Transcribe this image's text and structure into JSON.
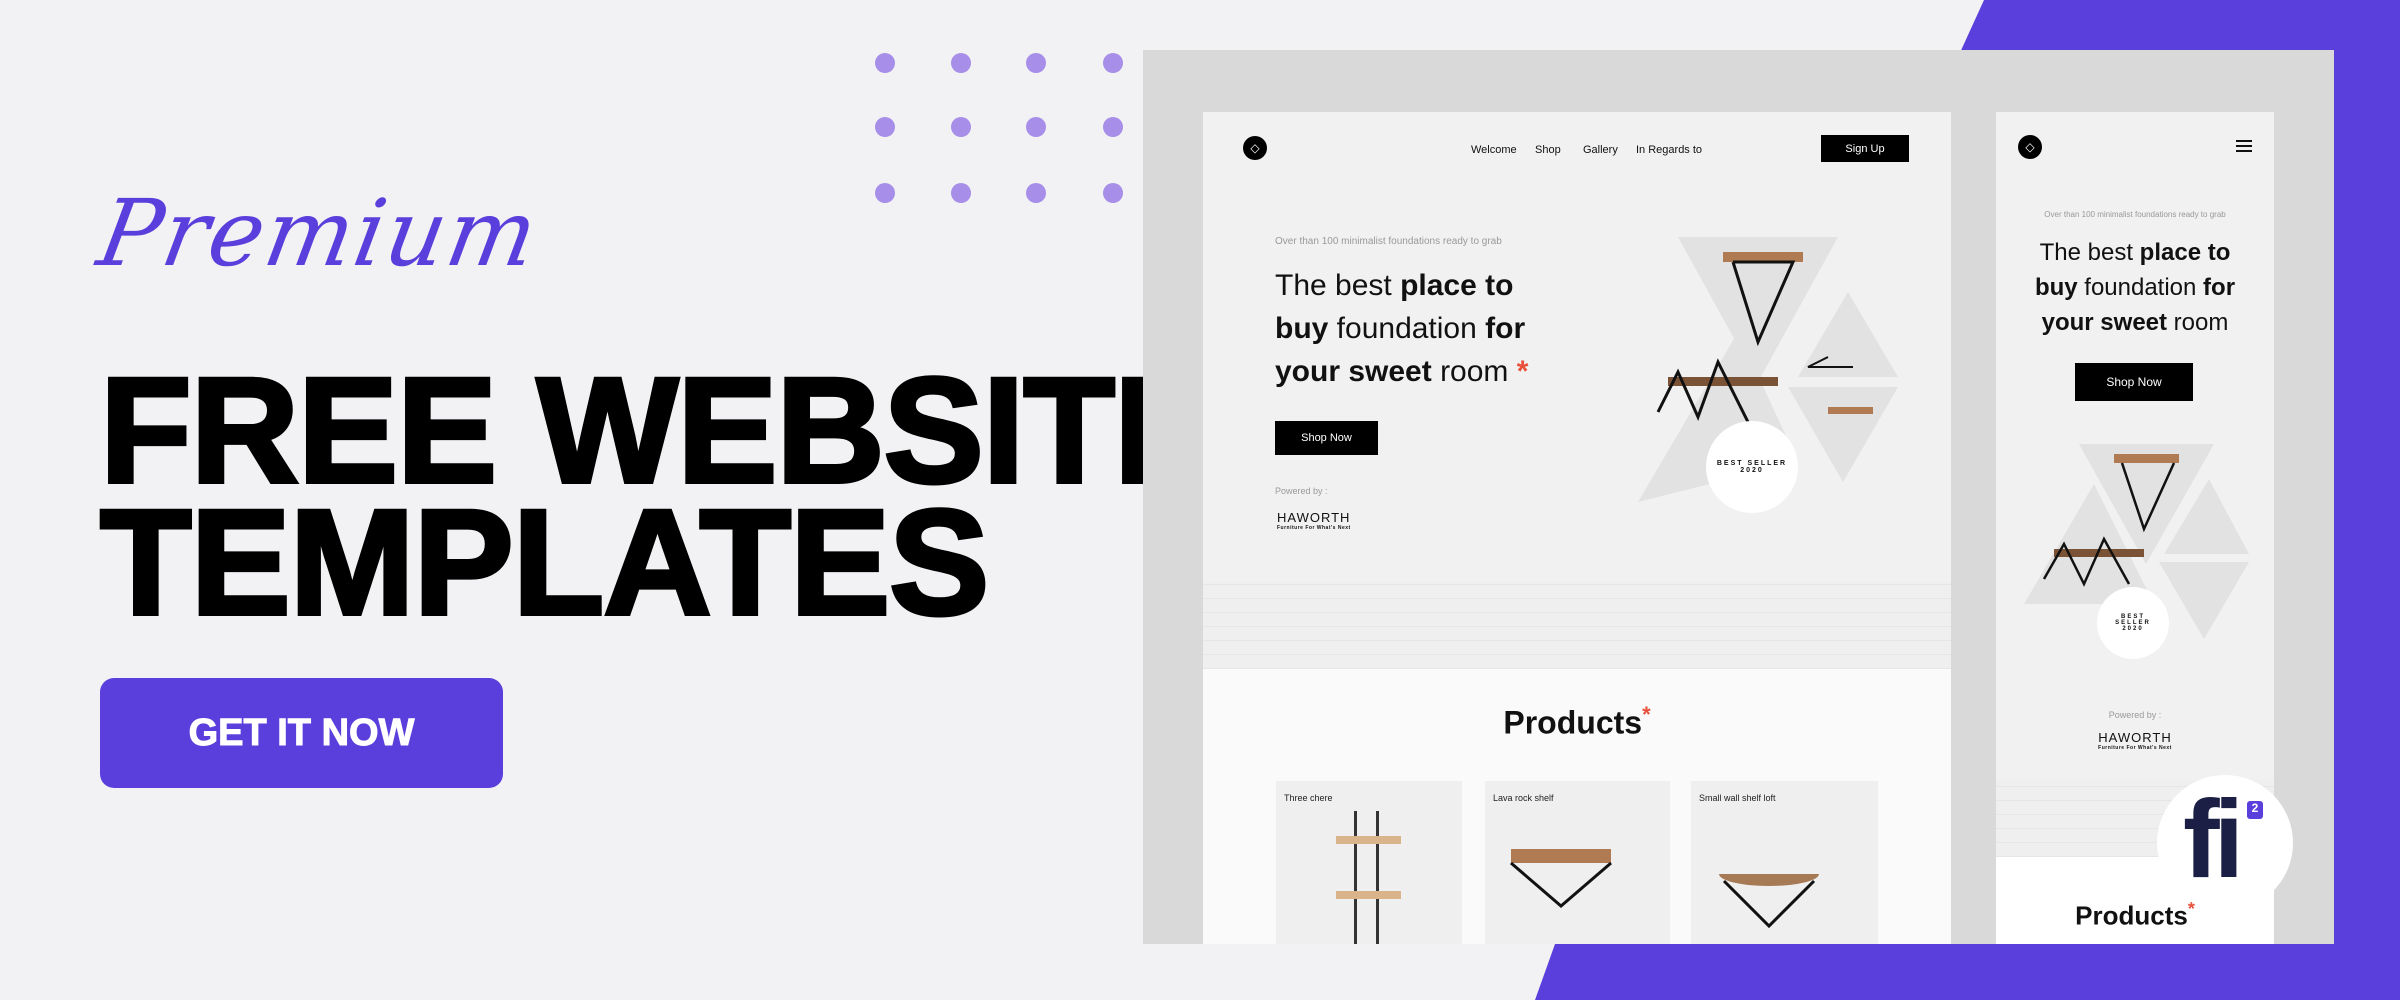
{
  "colors": {
    "accent": "#5b3fdc",
    "dots": "#a78ee8",
    "asterisk": "#e8503a",
    "background": "#f2f2f4"
  },
  "banner": {
    "script_title": "Premium",
    "headline_line1": "FREE WEBSITE",
    "headline_line2": "TEMPLATES",
    "cta_label": "GET IT NOW"
  },
  "desktop": {
    "logo_icon": "diamond-icon",
    "nav": [
      "Welcome",
      "Shop",
      "Gallery",
      "In Regards to"
    ],
    "signup_label": "Sign Up",
    "subtitle": "Over than 100 minimalist foundations ready to grab",
    "headline": {
      "l1a": "The best ",
      "l1b": "place to",
      "l2a": "buy",
      "l2b": " foundation ",
      "l2c": "for",
      "l3a": "your sweet",
      "l3b": " room ",
      "asterisk": "*"
    },
    "shop_now_label": "Shop Now",
    "powered_by": "Powered by :",
    "brand": "HAWORTH",
    "brand_tagline": "Furniture For What's Next",
    "badge": "BEST SELLER 2020",
    "products_title": "Products",
    "products_asterisk": "*",
    "cards": [
      {
        "label": "Three chere"
      },
      {
        "label": "Lava rock shelf"
      },
      {
        "label": "Small wall shelf loft"
      }
    ]
  },
  "mobile": {
    "menu_icon": "hamburger-icon",
    "subtitle": "Over than 100 minimalist foundations ready to grab",
    "headline": {
      "l1a": "The best ",
      "l1b": "place to",
      "l2a": "buy",
      "l2b": " foundation ",
      "l2c": "for",
      "l3a": "your sweet",
      "l3b": " room"
    },
    "shop_now_label": "Shop Now",
    "badge": "BEST SELLER 2020",
    "powered_by": "Powered by :",
    "brand": "HAWORTH",
    "brand_tagline": "Furniture For What's Next",
    "products_title": "Products",
    "products_asterisk": "*"
  },
  "site_logo": {
    "letters": "fi",
    "superscript": "2"
  }
}
